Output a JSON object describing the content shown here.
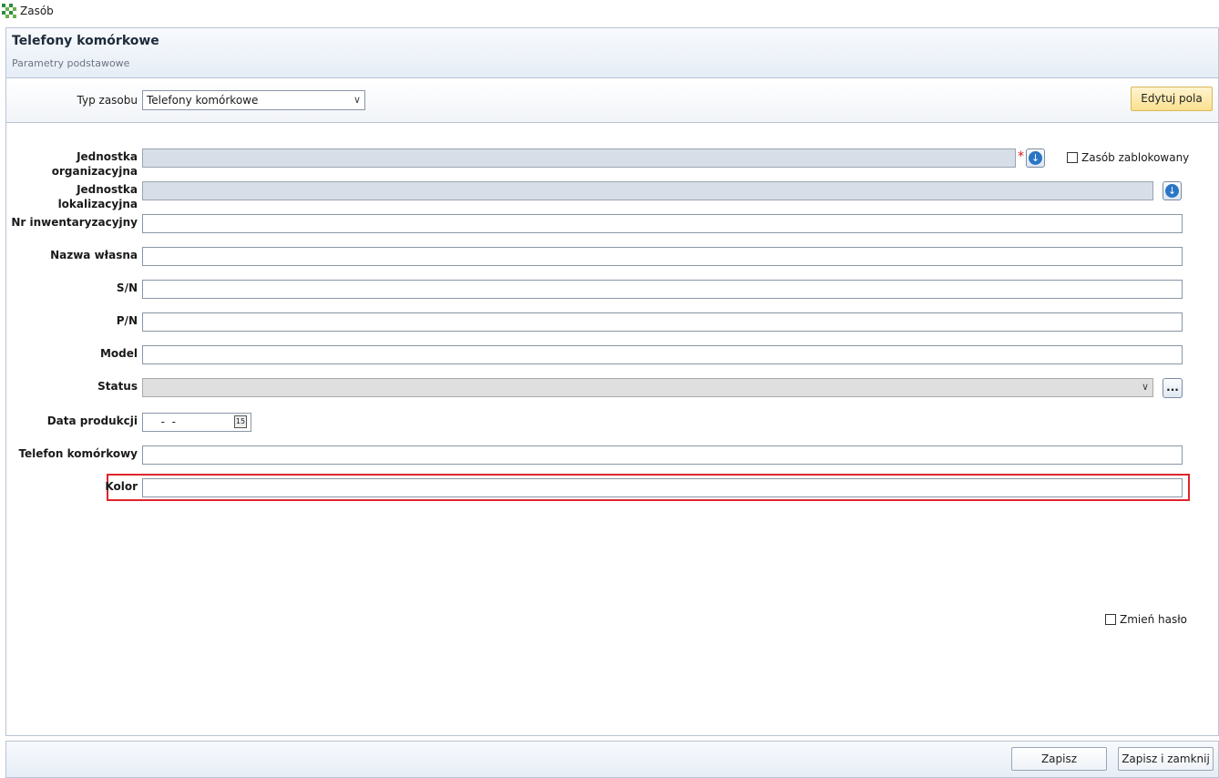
{
  "window": {
    "title": "Zasób",
    "icon": "app-grid-icon"
  },
  "header": {
    "title": "Telefony komórkowe",
    "subtitle": "Parametry podstawowe"
  },
  "type_bar": {
    "label": "Typ zasobu",
    "selected": "Telefony komórkowe",
    "edit_button": "Edytuj pola"
  },
  "form": {
    "org_unit_label": "Jednostka organizacyjna",
    "org_unit_required": "*",
    "locked_label": "Zasób zablokowany",
    "location_label": "Jednostka lokalizacyjna",
    "inventory_label": "Nr inwentaryzacyjny",
    "own_name_label": "Nazwa własna",
    "sn_label": "S/N",
    "pn_label": "P/N",
    "model_label": "Model",
    "status_label": "Status",
    "status_more": "...",
    "date_label": "Data produkcji",
    "date_value": "  -  -",
    "calendar_glyph": "15",
    "phone_label": "Telefon komórkowy",
    "color_label": "Kolor",
    "change_password_label": "Zmień hasło"
  },
  "footer": {
    "save": "Zapisz",
    "save_close": "Zapisz i zamknij"
  },
  "colors": {
    "highlight": "#e0242c",
    "edit_button": "#fbe08f",
    "accent": "#2a76c6"
  }
}
